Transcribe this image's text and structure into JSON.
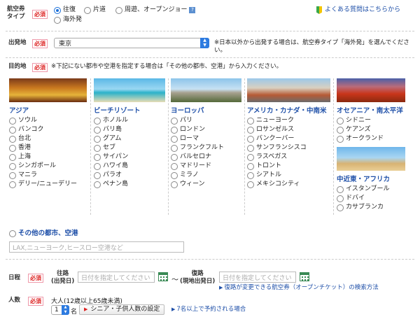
{
  "ticket_type": {
    "label_line1": "航空券",
    "label_line2": "タイプ",
    "required": "必須",
    "options": [
      "往復",
      "片道",
      "周遊、オープンジョー",
      "海外発"
    ],
    "selected": "往復",
    "help": "?"
  },
  "faq_link": "よくある質問はこちらから",
  "departure": {
    "label": "出発地",
    "required": "必須",
    "value": "東京",
    "note": "※日本以外から出発する場合は、航空券タイプ「海外発」を選んでください。"
  },
  "destination": {
    "label": "目的地",
    "required": "必須",
    "note": "※下記にない都市や空港を指定する場合は「その他の都市、空港」から入力ください。",
    "regions": [
      {
        "name": "アジア",
        "cities": [
          "ソウル",
          "バンコク",
          "台北",
          "香港",
          "上海",
          "シンガポール",
          "マニラ",
          "デリー/ニューデリー"
        ]
      },
      {
        "name": "ビーチリゾート",
        "cities": [
          "ホノルル",
          "バリ島",
          "グアム",
          "セブ",
          "サイパン",
          "ハワイ島",
          "パラオ",
          "ペナン島"
        ]
      },
      {
        "name": "ヨーロッパ",
        "cities": [
          "パリ",
          "ロンドン",
          "ローマ",
          "フランクフルト",
          "バルセロナ",
          "マドリード",
          "ミラノ",
          "ウィーン"
        ]
      },
      {
        "name": "アメリカ・カナダ・中南米",
        "cities": [
          "ニューヨーク",
          "ロサンゼルス",
          "バンクーバー",
          "サンフランシスコ",
          "ラスベガス",
          "トロント",
          "シアトル",
          "メキシコシティ"
        ]
      },
      {
        "name": "オセアニア・南太平洋",
        "cities": [
          "シドニー",
          "ケアンズ",
          "オークランド"
        ]
      },
      {
        "name": "中近東・アフリカ",
        "cities": [
          "イスタンブール",
          "ドバイ",
          "カサブランカ"
        ]
      }
    ],
    "other_label": "その他の都市、空港",
    "other_placeholder": "LAX,ニューヨーク,ヒースロー空港など"
  },
  "schedule": {
    "label": "日程",
    "required": "必須",
    "outbound_label1": "往路",
    "outbound_label2": "(出発日)",
    "return_label1": "復路",
    "return_label2": "(現地出発日)",
    "date_placeholder": "日付を指定してください",
    "tilde": "〜",
    "changeable_link": "復路が変更できる航空券（オープンチケット）の検索方法"
  },
  "passengers": {
    "label": "人数",
    "required": "必須",
    "adult_label": "大人(12歳以上65歳未満)",
    "adult_count": "1",
    "unit": "名",
    "senior_button": "シニア・子供人数の設定",
    "group_link": "7名以上で予約される場合"
  },
  "colors": {
    "accent": "#1a6fd8",
    "region_title": "#1e4fa8",
    "required": "#d22222"
  }
}
